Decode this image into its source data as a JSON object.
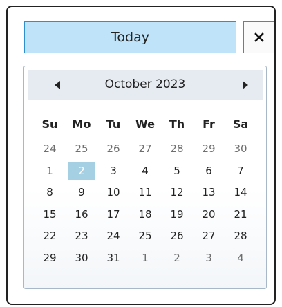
{
  "today_button": {
    "label": "Today"
  },
  "close_button": {
    "icon": "close-icon"
  },
  "calendar": {
    "month_label": "October 2023",
    "prev_icon": "triangle-left-icon",
    "next_icon": "triangle-right-icon",
    "weekdays": [
      "Su",
      "Mo",
      "Tu",
      "We",
      "Th",
      "Fr",
      "Sa"
    ],
    "weeks": [
      [
        "24",
        "25",
        "26",
        "27",
        "28",
        "29",
        "30"
      ],
      [
        "1",
        "2",
        "3",
        "4",
        "5",
        "6",
        "7"
      ],
      [
        "8",
        "9",
        "10",
        "11",
        "12",
        "13",
        "14"
      ],
      [
        "15",
        "16",
        "17",
        "18",
        "19",
        "20",
        "21"
      ],
      [
        "22",
        "23",
        "24",
        "25",
        "26",
        "27",
        "28"
      ],
      [
        "29",
        "30",
        "31",
        "1",
        "2",
        "3",
        "4"
      ]
    ],
    "other_month_days": [
      [
        true,
        true,
        true,
        true,
        true,
        true,
        true
      ],
      [
        false,
        false,
        false,
        false,
        false,
        false,
        false
      ],
      [
        false,
        false,
        false,
        false,
        false,
        false,
        false
      ],
      [
        false,
        false,
        false,
        false,
        false,
        false,
        false
      ],
      [
        false,
        false,
        false,
        false,
        false,
        false,
        false
      ],
      [
        false,
        false,
        false,
        true,
        true,
        true,
        true
      ]
    ],
    "selected": {
      "week": 1,
      "day": 1
    },
    "colors": {
      "selected_background": "#a5cfe3",
      "today_button_background": "#bfe3f8",
      "header_background": "#e6ebf1"
    }
  }
}
